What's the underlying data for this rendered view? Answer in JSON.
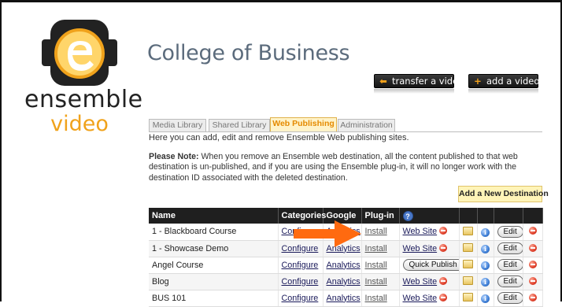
{
  "brand": {
    "name": "ensemble",
    "sub": "video"
  },
  "page_title": "College of Business",
  "toolbar": {
    "transfer_label": "transfer a video",
    "transfer_icon": "arrow-left-icon",
    "add_video_label": "add a video",
    "add_video_icon": "plus-icon"
  },
  "tabs": [
    {
      "label": "Media Library"
    },
    {
      "label": "Shared Library"
    },
    {
      "label": "Web Publishing"
    },
    {
      "label": "Administration"
    }
  ],
  "intro": "Here you can add, edit and remove Ensemble Web publishing sites.",
  "note": {
    "bold": "Please Note:",
    "text": " When you remove an Ensemble web destination, all the content published to that web destination is un-published, and if you are using the Ensemble plug-in, it will no longer work with the destination ID associated with the deleted destination."
  },
  "add_destination_label": "Add a New Destination",
  "table": {
    "headers": {
      "name": "Name",
      "categories": "Categories",
      "google": "Google",
      "plugin": "Plug-in",
      "help": "?"
    },
    "rows": [
      {
        "name": "1 - Blackboard Course",
        "categories": "Configure",
        "google": "Analytics",
        "plugin": "Install",
        "site": "Web Site",
        "edit": "Edit"
      },
      {
        "name": "1 - Showcase Demo",
        "categories": "Configure",
        "google": "Analytics",
        "plugin": "Install",
        "site": "Web Site",
        "edit": "Edit"
      },
      {
        "name": "Angel Course",
        "categories": "Configure",
        "google": "Analytics",
        "plugin": "Install",
        "site": "Quick Publish",
        "edit": "Edit"
      },
      {
        "name": "Blog",
        "categories": "Configure",
        "google": "Analytics",
        "plugin": "Install",
        "site": "Web Site",
        "edit": "Edit"
      },
      {
        "name": "BUS 101",
        "categories": "Configure",
        "google": "Analytics",
        "plugin": "Install",
        "site": "Web Site",
        "edit": "Edit"
      }
    ]
  },
  "colors": {
    "accent": "#f0a21b",
    "title": "#5b6b7c",
    "arrow": "#ff6a10",
    "header_bg": "#1f1f1f"
  }
}
